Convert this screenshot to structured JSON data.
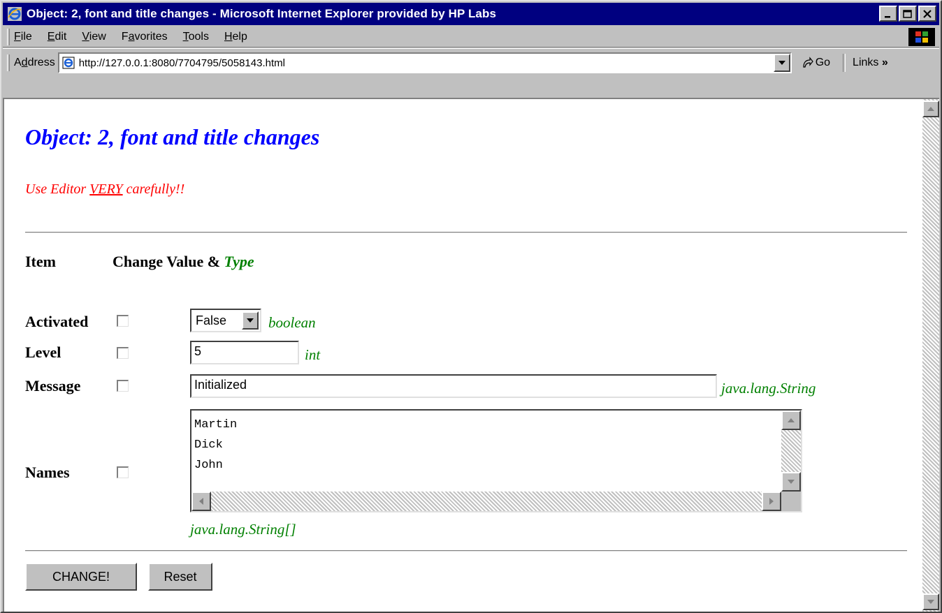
{
  "window": {
    "title": "Object: 2, font and title changes - Microsoft Internet Explorer provided by HP Labs"
  },
  "menu": {
    "items": [
      {
        "label": "File",
        "mnemonic": "F",
        "rest": "ile"
      },
      {
        "label": "Edit",
        "mnemonic": "E",
        "rest": "dit"
      },
      {
        "label": "View",
        "mnemonic": "V",
        "rest": "iew"
      },
      {
        "label": "Favorites",
        "pre": "F",
        "mnemonic": "a",
        "rest": "vorites"
      },
      {
        "label": "Tools",
        "mnemonic": "T",
        "rest": "ools"
      },
      {
        "label": "Help",
        "mnemonic": "H",
        "rest": "elp"
      }
    ]
  },
  "address_bar": {
    "label_pre": "A",
    "label_mnemonic": "d",
    "label_rest": "dress",
    "url": "http://127.0.0.1:8080/7704795/5058143.html",
    "go_label": "Go",
    "links_label": "Links"
  },
  "page": {
    "heading": "Object: 2, font and title changes",
    "warning_pre": "Use Editor ",
    "warning_em": "VERY",
    "warning_post": " carefully!!",
    "col_item": "Item",
    "col_change": "Change Value & ",
    "col_type": "Type",
    "rows": [
      {
        "label": "Activated",
        "value": "False",
        "type": "boolean"
      },
      {
        "label": "Level",
        "value": "5",
        "type": "int"
      },
      {
        "label": "Message",
        "value": "Initialized",
        "type": "java.lang.String"
      },
      {
        "label": "Names",
        "lines": [
          "Martin",
          "Dick",
          "John"
        ],
        "type": "java.lang.String[]"
      }
    ],
    "change_button": "CHANGE!",
    "reset_button": "Reset"
  },
  "colors": {
    "titlebar": "#000080",
    "heading": "#0000ff",
    "warning": "#ff0000",
    "type": "#008000"
  }
}
